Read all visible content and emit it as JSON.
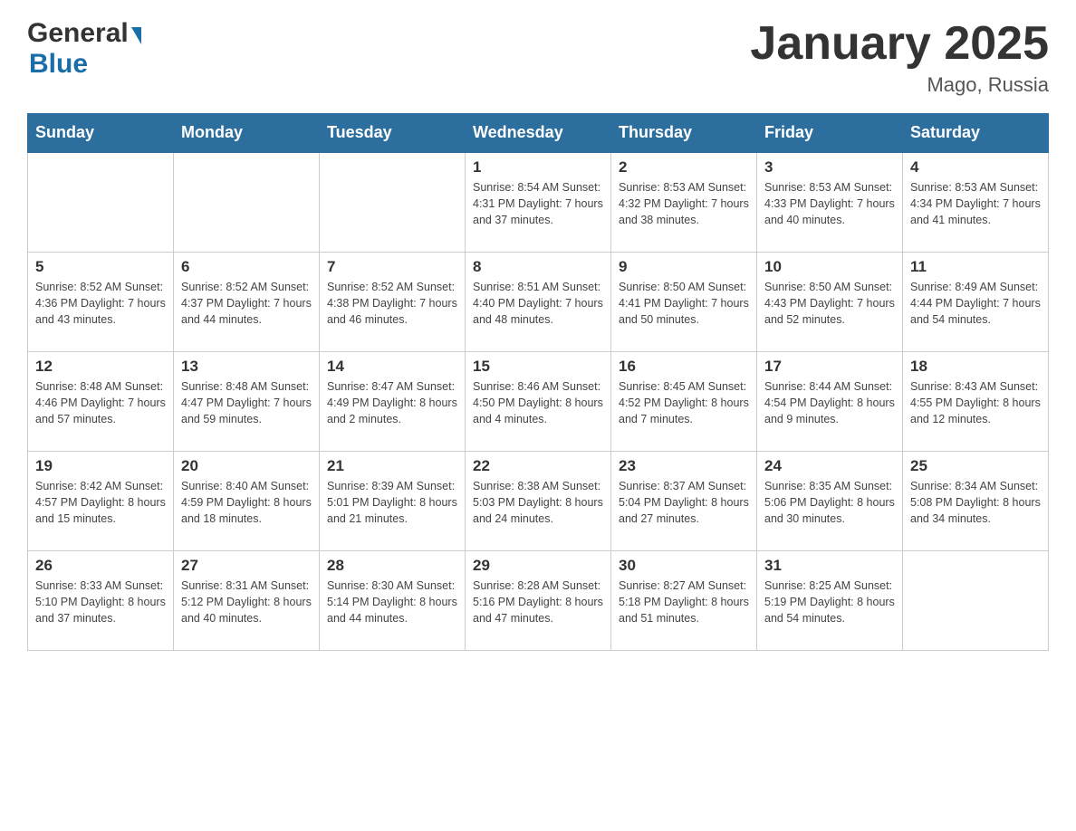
{
  "header": {
    "logo_general": "General",
    "logo_blue": "Blue",
    "title": "January 2025",
    "subtitle": "Mago, Russia"
  },
  "weekdays": [
    "Sunday",
    "Monday",
    "Tuesday",
    "Wednesday",
    "Thursday",
    "Friday",
    "Saturday"
  ],
  "weeks": [
    [
      {
        "day": "",
        "info": ""
      },
      {
        "day": "",
        "info": ""
      },
      {
        "day": "",
        "info": ""
      },
      {
        "day": "1",
        "info": "Sunrise: 8:54 AM\nSunset: 4:31 PM\nDaylight: 7 hours\nand 37 minutes."
      },
      {
        "day": "2",
        "info": "Sunrise: 8:53 AM\nSunset: 4:32 PM\nDaylight: 7 hours\nand 38 minutes."
      },
      {
        "day": "3",
        "info": "Sunrise: 8:53 AM\nSunset: 4:33 PM\nDaylight: 7 hours\nand 40 minutes."
      },
      {
        "day": "4",
        "info": "Sunrise: 8:53 AM\nSunset: 4:34 PM\nDaylight: 7 hours\nand 41 minutes."
      }
    ],
    [
      {
        "day": "5",
        "info": "Sunrise: 8:52 AM\nSunset: 4:36 PM\nDaylight: 7 hours\nand 43 minutes."
      },
      {
        "day": "6",
        "info": "Sunrise: 8:52 AM\nSunset: 4:37 PM\nDaylight: 7 hours\nand 44 minutes."
      },
      {
        "day": "7",
        "info": "Sunrise: 8:52 AM\nSunset: 4:38 PM\nDaylight: 7 hours\nand 46 minutes."
      },
      {
        "day": "8",
        "info": "Sunrise: 8:51 AM\nSunset: 4:40 PM\nDaylight: 7 hours\nand 48 minutes."
      },
      {
        "day": "9",
        "info": "Sunrise: 8:50 AM\nSunset: 4:41 PM\nDaylight: 7 hours\nand 50 minutes."
      },
      {
        "day": "10",
        "info": "Sunrise: 8:50 AM\nSunset: 4:43 PM\nDaylight: 7 hours\nand 52 minutes."
      },
      {
        "day": "11",
        "info": "Sunrise: 8:49 AM\nSunset: 4:44 PM\nDaylight: 7 hours\nand 54 minutes."
      }
    ],
    [
      {
        "day": "12",
        "info": "Sunrise: 8:48 AM\nSunset: 4:46 PM\nDaylight: 7 hours\nand 57 minutes."
      },
      {
        "day": "13",
        "info": "Sunrise: 8:48 AM\nSunset: 4:47 PM\nDaylight: 7 hours\nand 59 minutes."
      },
      {
        "day": "14",
        "info": "Sunrise: 8:47 AM\nSunset: 4:49 PM\nDaylight: 8 hours\nand 2 minutes."
      },
      {
        "day": "15",
        "info": "Sunrise: 8:46 AM\nSunset: 4:50 PM\nDaylight: 8 hours\nand 4 minutes."
      },
      {
        "day": "16",
        "info": "Sunrise: 8:45 AM\nSunset: 4:52 PM\nDaylight: 8 hours\nand 7 minutes."
      },
      {
        "day": "17",
        "info": "Sunrise: 8:44 AM\nSunset: 4:54 PM\nDaylight: 8 hours\nand 9 minutes."
      },
      {
        "day": "18",
        "info": "Sunrise: 8:43 AM\nSunset: 4:55 PM\nDaylight: 8 hours\nand 12 minutes."
      }
    ],
    [
      {
        "day": "19",
        "info": "Sunrise: 8:42 AM\nSunset: 4:57 PM\nDaylight: 8 hours\nand 15 minutes."
      },
      {
        "day": "20",
        "info": "Sunrise: 8:40 AM\nSunset: 4:59 PM\nDaylight: 8 hours\nand 18 minutes."
      },
      {
        "day": "21",
        "info": "Sunrise: 8:39 AM\nSunset: 5:01 PM\nDaylight: 8 hours\nand 21 minutes."
      },
      {
        "day": "22",
        "info": "Sunrise: 8:38 AM\nSunset: 5:03 PM\nDaylight: 8 hours\nand 24 minutes."
      },
      {
        "day": "23",
        "info": "Sunrise: 8:37 AM\nSunset: 5:04 PM\nDaylight: 8 hours\nand 27 minutes."
      },
      {
        "day": "24",
        "info": "Sunrise: 8:35 AM\nSunset: 5:06 PM\nDaylight: 8 hours\nand 30 minutes."
      },
      {
        "day": "25",
        "info": "Sunrise: 8:34 AM\nSunset: 5:08 PM\nDaylight: 8 hours\nand 34 minutes."
      }
    ],
    [
      {
        "day": "26",
        "info": "Sunrise: 8:33 AM\nSunset: 5:10 PM\nDaylight: 8 hours\nand 37 minutes."
      },
      {
        "day": "27",
        "info": "Sunrise: 8:31 AM\nSunset: 5:12 PM\nDaylight: 8 hours\nand 40 minutes."
      },
      {
        "day": "28",
        "info": "Sunrise: 8:30 AM\nSunset: 5:14 PM\nDaylight: 8 hours\nand 44 minutes."
      },
      {
        "day": "29",
        "info": "Sunrise: 8:28 AM\nSunset: 5:16 PM\nDaylight: 8 hours\nand 47 minutes."
      },
      {
        "day": "30",
        "info": "Sunrise: 8:27 AM\nSunset: 5:18 PM\nDaylight: 8 hours\nand 51 minutes."
      },
      {
        "day": "31",
        "info": "Sunrise: 8:25 AM\nSunset: 5:19 PM\nDaylight: 8 hours\nand 54 minutes."
      },
      {
        "day": "",
        "info": ""
      }
    ]
  ]
}
